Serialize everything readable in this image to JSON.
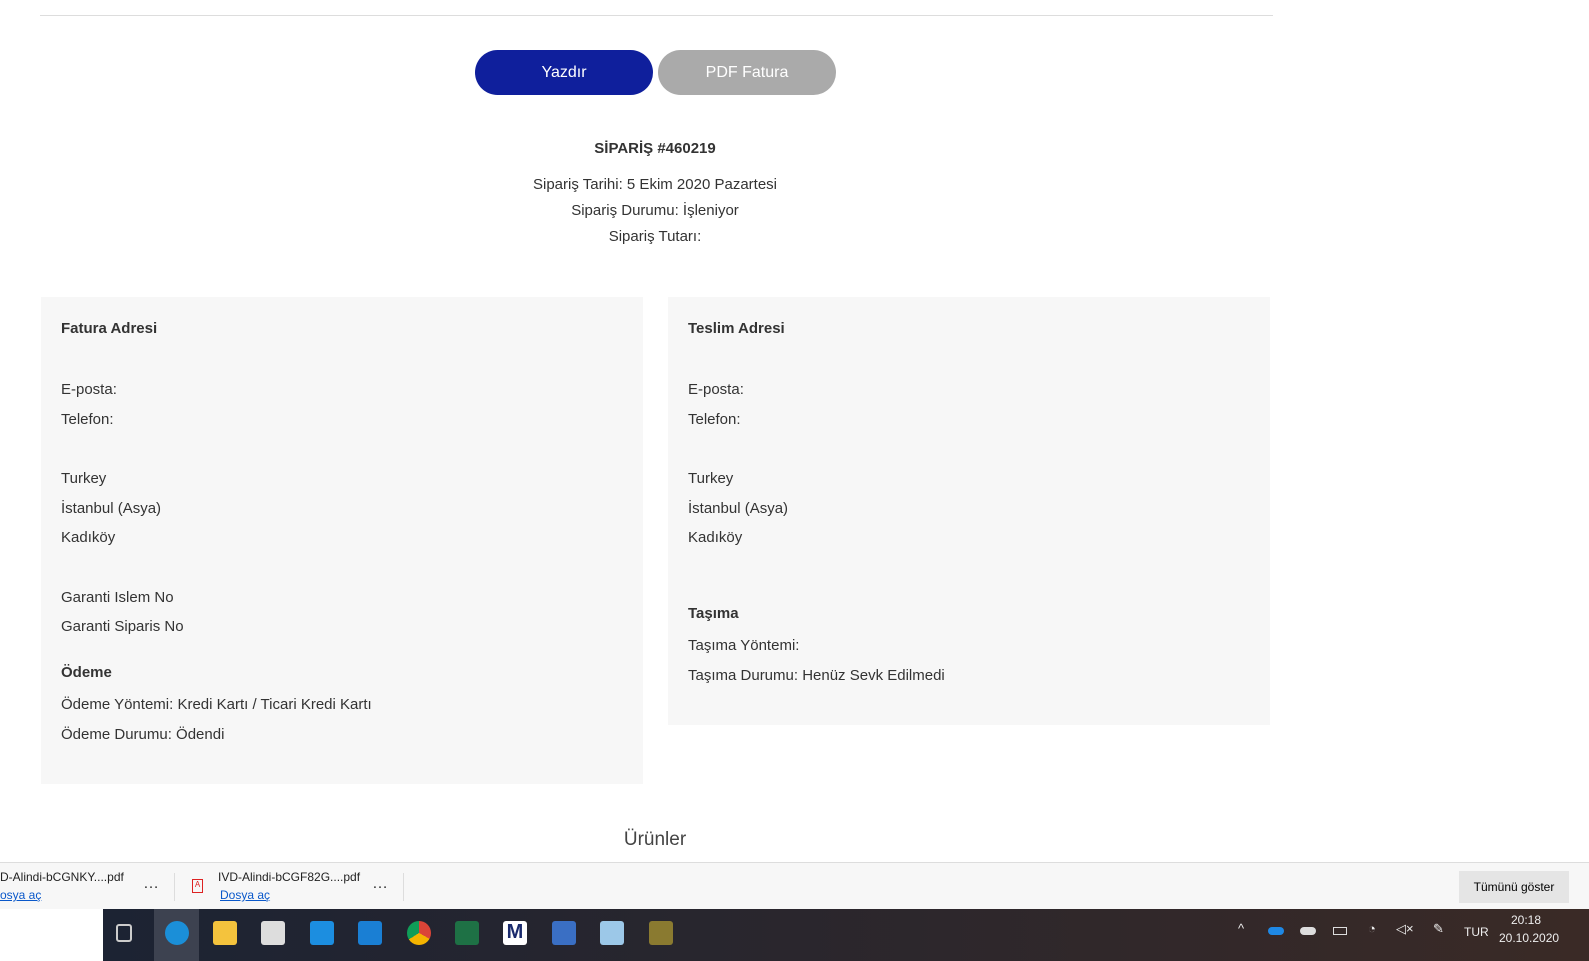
{
  "buttons": {
    "print": "Yazdır",
    "pdf": "PDF Fatura"
  },
  "order": {
    "title": "SİPARİŞ #460219",
    "date": "Sipariş Tarihi: 5 Ekim 2020 Pazartesi",
    "status": "Sipariş Durumu: İşleniyor",
    "total": "Sipariş Tutarı:"
  },
  "billing": {
    "title": "Fatura Adresi",
    "email": "E-posta:",
    "phone": "Telefon:",
    "country": "Turkey",
    "city": "İstanbul (Asya)",
    "district": "Kadıköy",
    "garanti_islem": "Garanti Islem No",
    "garanti_siparis": "Garanti Siparis No",
    "payment_title": "Ödeme",
    "payment_method": "Ödeme Yöntemi: Kredi Kartı / Ticari Kredi Kartı",
    "payment_status": "Ödeme Durumu: Ödendi"
  },
  "shipping": {
    "title": "Teslim Adresi",
    "email": "E-posta:",
    "phone": "Telefon:",
    "country": "Turkey",
    "city": "İstanbul (Asya)",
    "district": "Kadıköy",
    "ship_title": "Taşıma",
    "ship_method": "Taşıma Yöntemi:",
    "ship_status": "Taşıma Durumu: Henüz Sevk Edilmedi"
  },
  "products_title": "Ürünler",
  "downloads": [
    {
      "name": "D-Alindi-bCGNKY....pdf",
      "open": "osya aç"
    },
    {
      "name": "IVD-Alindi-bCGF82G....pdf",
      "open": "Dosya aç"
    }
  ],
  "show_all": "Tümünü göster",
  "tray": {
    "lang": "TUR",
    "time": "20:18",
    "date": "20.10.2020"
  }
}
